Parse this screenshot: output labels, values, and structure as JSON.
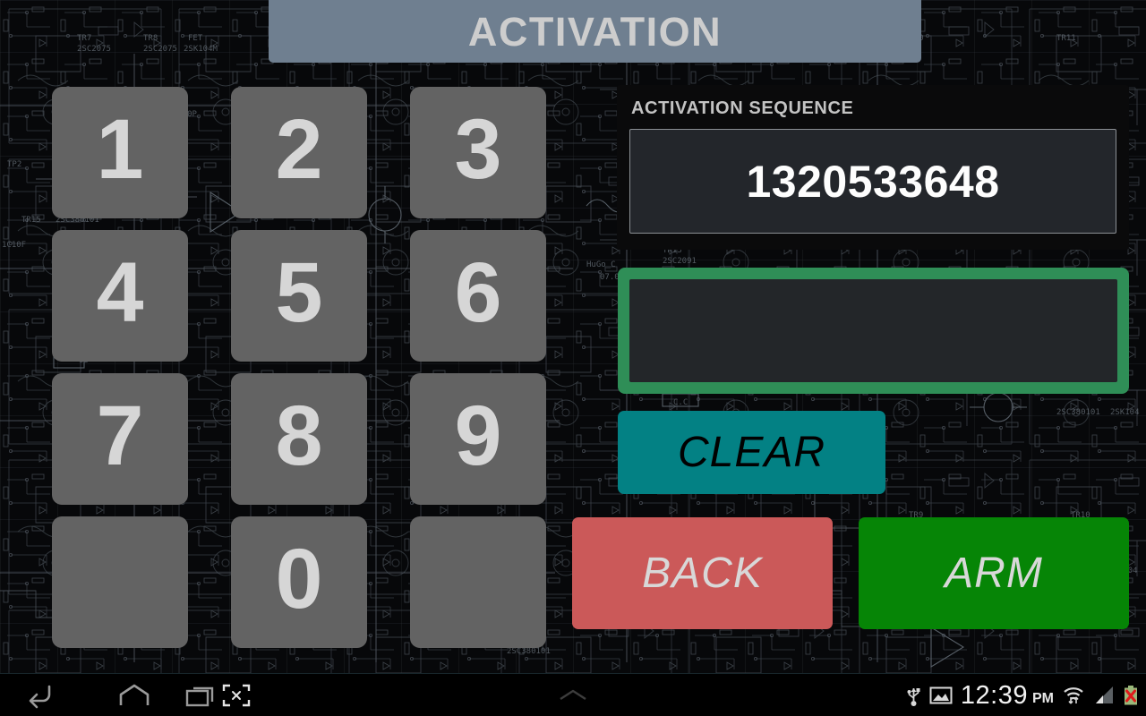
{
  "header": {
    "title": "ACTIVATION"
  },
  "keypad": {
    "keys": [
      {
        "label": "1",
        "name": "key-1",
        "blank": false
      },
      {
        "label": "2",
        "name": "key-2",
        "blank": false
      },
      {
        "label": "3",
        "name": "key-3",
        "blank": false
      },
      {
        "label": "4",
        "name": "key-4",
        "blank": false
      },
      {
        "label": "5",
        "name": "key-5",
        "blank": false
      },
      {
        "label": "6",
        "name": "key-6",
        "blank": false
      },
      {
        "label": "7",
        "name": "key-7",
        "blank": false
      },
      {
        "label": "8",
        "name": "key-8",
        "blank": false
      },
      {
        "label": "9",
        "name": "key-9",
        "blank": false
      },
      {
        "label": "",
        "name": "key-blank-left",
        "blank": true
      },
      {
        "label": "0",
        "name": "key-0",
        "blank": false
      },
      {
        "label": "",
        "name": "key-blank-right",
        "blank": true
      }
    ]
  },
  "sequence_panel": {
    "label": "ACTIVATION SEQUENCE",
    "value": "1320533648"
  },
  "entry": {
    "value": "",
    "placeholder": ""
  },
  "actions": {
    "clear_label": "CLEAR",
    "back_label": "BACK",
    "arm_label": "ARM"
  },
  "colors": {
    "header_bar": "#6f7f90",
    "key": "#636363",
    "key_text": "#d6d6d6",
    "panel_bg": "#0a0a0b",
    "display_bg": "#23262b",
    "entry_border_green": "#2f8e57",
    "clear_teal": "#038184",
    "back_red": "#cb5959",
    "arm_green": "#068506",
    "background": "#07080a"
  },
  "navbar": {
    "buttons": [
      {
        "name": "nav-back-button",
        "icon": "back-arrow-icon"
      },
      {
        "name": "nav-home-button",
        "icon": "home-icon"
      },
      {
        "name": "nav-recents-button",
        "icon": "recents-icon"
      },
      {
        "name": "nav-screenshot-button",
        "icon": "screenshot-icon"
      },
      {
        "name": "nav-drawer-handle",
        "icon": "chevron-up-icon"
      }
    ]
  },
  "status": {
    "time": "12:39",
    "ampm": "PM",
    "icons": [
      "usb-icon",
      "screenshot-captured-icon",
      "wifi-icon",
      "signal-bars-icon",
      "battery-error-icon"
    ]
  }
}
